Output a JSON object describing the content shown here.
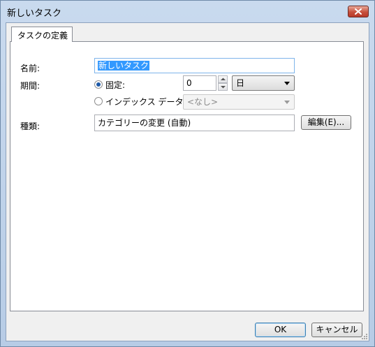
{
  "window": {
    "title": "新しいタスク"
  },
  "tabs": [
    {
      "label": "タスクの定義"
    }
  ],
  "form": {
    "name_label": "名前:",
    "name_value": "新しいタスク",
    "period_label": "期間:",
    "fixed_label": "固定:",
    "fixed_checked": true,
    "fixed_value": "0",
    "unit_value": "日",
    "index_label": "インデックス データ:",
    "index_checked": false,
    "index_value": "<なし>",
    "type_label": "種類:",
    "type_value": "カテゴリーの変更 (自動)",
    "edit_button": "編集(E)..."
  },
  "footer": {
    "ok": "OK",
    "cancel": "キャンセル"
  },
  "icons": [
    "close-icon",
    "spin-up-icon",
    "spin-down-icon",
    "dropdown-arrow-icon",
    "resize-grip-icon"
  ]
}
